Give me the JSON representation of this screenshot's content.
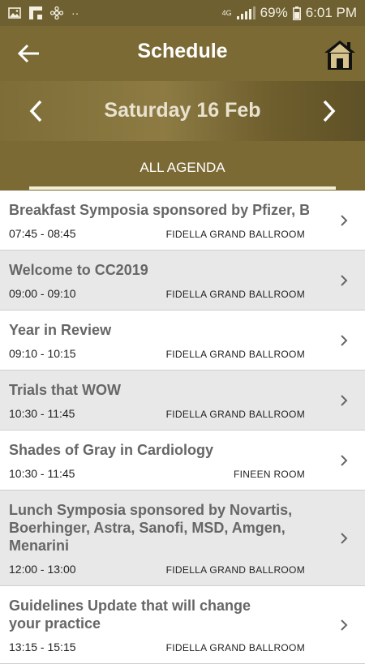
{
  "status_bar": {
    "network": "4G",
    "battery": "69%",
    "time": "6:01 PM"
  },
  "header": {
    "title": "Schedule",
    "date": "Saturday 16 Feb",
    "tab": "ALL AGENDA"
  },
  "colors": {
    "header_bg": "#7b6a34",
    "status_bg": "#6e6030",
    "alt_row": "#e8e8e8"
  },
  "agenda": [
    {
      "title": "Breakfast Symposia sponsored by Pfizer, BI",
      "time": "07:45 - 08:45",
      "room": "FIDELLA GRAND BALLROOM"
    },
    {
      "title": "Welcome to CC2019",
      "time": "09:00 - 09:10",
      "room": "FIDELLA GRAND BALLROOM"
    },
    {
      "title": "Year in Review",
      "time": "09:10 - 10:15",
      "room": "FIDELLA GRAND BALLROOM"
    },
    {
      "title": "Trials that WOW",
      "time": "10:30 - 11:45",
      "room": "FIDELLA GRAND BALLROOM"
    },
    {
      "title": "Shades of Gray in Cardiology",
      "time": "10:30 - 11:45",
      "room": "FINEEN ROOM"
    },
    {
      "title": "Lunch Symposia sponsored by Novartis, Boerhinger, Astra, Sanofi, MSD, Amgen, Menarini",
      "time": "12:00 - 13:00",
      "room": "FIDELLA GRAND BALLROOM"
    },
    {
      "title": "Guidelines Update that will change your practice",
      "time": "13:15 - 15:15",
      "room": "FIDELLA GRAND BALLROOM"
    }
  ]
}
